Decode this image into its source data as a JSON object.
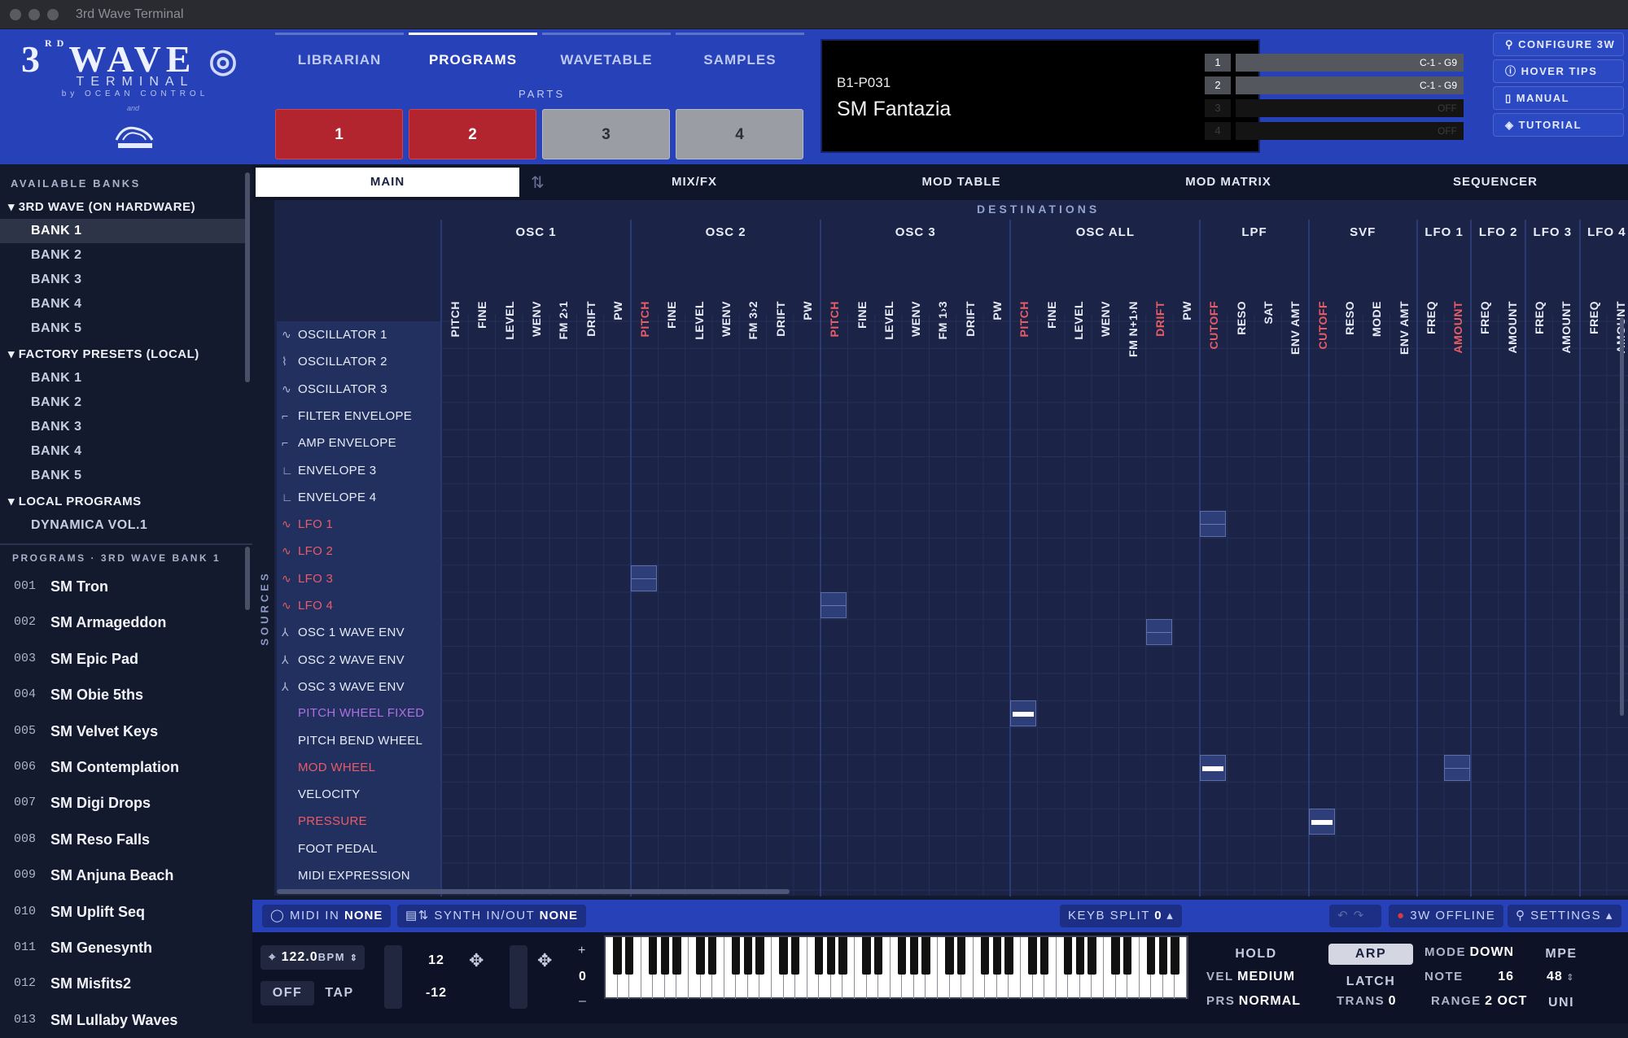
{
  "app": {
    "window_title": "3rd Wave Terminal"
  },
  "logo": {
    "wave": "3RDWAVE",
    "terminal": "TERMINAL",
    "by": "by OCEAN CONTROL",
    "and": "and"
  },
  "nav": {
    "tabs": [
      "LIBRARIAN",
      "PROGRAMS",
      "WAVETABLE",
      "SAMPLES"
    ],
    "active": "PROGRAMS"
  },
  "parts": {
    "label": "PARTS",
    "buttons": [
      "1",
      "2",
      "3",
      "4"
    ]
  },
  "display": {
    "program_id": "B1-P031",
    "program_name": "SM Fantazia",
    "parts": [
      {
        "n": "1",
        "range": "C-1 - G9"
      },
      {
        "n": "2",
        "range": "C-1 - G9"
      },
      {
        "n": "3",
        "range": "OFF"
      },
      {
        "n": "4",
        "range": "OFF"
      }
    ]
  },
  "right_buttons": [
    "CONFIGURE 3W",
    "HOVER TIPS",
    "MANUAL",
    "TUTORIAL"
  ],
  "sidebar": {
    "banks_header": "AVAILABLE BANKS",
    "groups": [
      {
        "title": "3RD WAVE (ON HARDWARE)",
        "items": [
          "BANK 1",
          "BANK 2",
          "BANK 3",
          "BANK 4",
          "BANK 5"
        ]
      },
      {
        "title": "FACTORY PRESETS (LOCAL)",
        "items": [
          "BANK 1",
          "BANK 2",
          "BANK 3",
          "BANK 4",
          "BANK 5"
        ]
      },
      {
        "title": "LOCAL PROGRAMS",
        "items": [
          "DYNAMICA VOL.1"
        ]
      }
    ],
    "programs_header": "PROGRAMS · 3RD WAVE BANK 1",
    "programs": [
      {
        "n": "001",
        "name": "SM Tron"
      },
      {
        "n": "002",
        "name": "SM Armageddon"
      },
      {
        "n": "003",
        "name": "SM Epic Pad"
      },
      {
        "n": "004",
        "name": "SM Obie 5ths"
      },
      {
        "n": "005",
        "name": "SM Velvet Keys"
      },
      {
        "n": "006",
        "name": "SM Contemplation"
      },
      {
        "n": "007",
        "name": "SM Digi Drops"
      },
      {
        "n": "008",
        "name": "SM Reso Falls"
      },
      {
        "n": "009",
        "name": "SM Anjuna Beach"
      },
      {
        "n": "010",
        "name": "SM Uplift Seq"
      },
      {
        "n": "011",
        "name": "SM Genesynth"
      },
      {
        "n": "012",
        "name": "SM Misfits2"
      },
      {
        "n": "013",
        "name": "SM Lullaby Waves"
      }
    ]
  },
  "subtabs": [
    "MAIN",
    "MIX/FX",
    "MOD TABLE",
    "MOD MATRIX",
    "SEQUENCER"
  ],
  "matrix": {
    "destinations_label": "DESTINATIONS",
    "sources_label": "SOURCES",
    "groups": [
      {
        "name": "OSC 1",
        "cols": [
          {
            "l": "PITCH",
            "red": false
          },
          {
            "l": "FINE"
          },
          {
            "l": "LEVEL"
          },
          {
            "l": "WENV"
          },
          {
            "l": "FM 2›1"
          },
          {
            "l": "DRIFT"
          },
          {
            "l": "PW"
          }
        ]
      },
      {
        "name": "OSC 2",
        "cols": [
          {
            "l": "PITCH",
            "red": true
          },
          {
            "l": "FINE"
          },
          {
            "l": "LEVEL"
          },
          {
            "l": "WENV"
          },
          {
            "l": "FM 3›2"
          },
          {
            "l": "DRIFT"
          },
          {
            "l": "PW"
          }
        ]
      },
      {
        "name": "OSC 3",
        "cols": [
          {
            "l": "PITCH",
            "red": true
          },
          {
            "l": "FINE"
          },
          {
            "l": "LEVEL"
          },
          {
            "l": "WENV"
          },
          {
            "l": "FM 1›3"
          },
          {
            "l": "DRIFT"
          },
          {
            "l": "PW"
          }
        ]
      },
      {
        "name": "OSC ALL",
        "cols": [
          {
            "l": "PITCH",
            "red": true
          },
          {
            "l": "FINE"
          },
          {
            "l": "LEVEL"
          },
          {
            "l": "WENV"
          },
          {
            "l": "FM N+1›N"
          },
          {
            "l": "DRIFT",
            "red": true
          },
          {
            "l": "PW"
          }
        ]
      },
      {
        "name": "LPF",
        "cols": [
          {
            "l": "CUTOFF",
            "red": true
          },
          {
            "l": "RESO"
          },
          {
            "l": "SAT"
          },
          {
            "l": "ENV AMT"
          }
        ]
      },
      {
        "name": "SVF",
        "cols": [
          {
            "l": "CUTOFF",
            "red": true
          },
          {
            "l": "RESO"
          },
          {
            "l": "MODE"
          },
          {
            "l": "ENV AMT"
          }
        ]
      },
      {
        "name": "LFO 1",
        "cols": [
          {
            "l": "FREQ"
          },
          {
            "l": "AMOUNT",
            "red": true
          }
        ]
      },
      {
        "name": "LFO 2",
        "cols": [
          {
            "l": "FREQ"
          },
          {
            "l": "AMOUNT"
          }
        ]
      },
      {
        "name": "LFO 3",
        "cols": [
          {
            "l": "FREQ"
          },
          {
            "l": "AMOUNT"
          }
        ]
      },
      {
        "name": "LFO 4",
        "cols": [
          {
            "l": "FREQ"
          },
          {
            "l": "AMOUNT"
          }
        ]
      }
    ],
    "sources": [
      {
        "l": "OSCILLATOR 1",
        "ic": "∿"
      },
      {
        "l": "OSCILLATOR 2",
        "ic": "⌇"
      },
      {
        "l": "OSCILLATOR 3",
        "ic": "∿"
      },
      {
        "l": "FILTER ENVELOPE",
        "ic": "⌐"
      },
      {
        "l": "AMP ENVELOPE",
        "ic": "⌐"
      },
      {
        "l": "ENVELOPE 3",
        "ic": "∟"
      },
      {
        "l": "ENVELOPE 4",
        "ic": "∟"
      },
      {
        "l": "LFO 1",
        "ic": "∿",
        "c": "red"
      },
      {
        "l": "LFO 2",
        "ic": "∿",
        "c": "red"
      },
      {
        "l": "LFO 3",
        "ic": "∿",
        "c": "red"
      },
      {
        "l": "LFO 4",
        "ic": "∿",
        "c": "red"
      },
      {
        "l": "OSC 1 WAVE ENV",
        "ic": "⅄"
      },
      {
        "l": "OSC 2 WAVE ENV",
        "ic": "⅄"
      },
      {
        "l": "OSC 3 WAVE ENV",
        "ic": "⅄"
      },
      {
        "l": "PITCH WHEEL FIXED",
        "ic": "",
        "c": "purple"
      },
      {
        "l": "PITCH BEND WHEEL",
        "ic": ""
      },
      {
        "l": "MOD WHEEL",
        "ic": "",
        "c": "red"
      },
      {
        "l": "VELOCITY",
        "ic": ""
      },
      {
        "l": "PRESSURE",
        "ic": "",
        "c": "red"
      },
      {
        "l": "FOOT PEDAL",
        "ic": ""
      },
      {
        "l": "MIDI EXPRESSION",
        "ic": ""
      }
    ],
    "marks": [
      {
        "row": 9,
        "col": 7,
        "bar": false
      },
      {
        "row": 7,
        "col": 28,
        "bar": false
      },
      {
        "row": 10,
        "col": 14,
        "bar": false
      },
      {
        "row": 11,
        "col": 26,
        "bar": false
      },
      {
        "row": 14,
        "col": 21,
        "bar": true
      },
      {
        "row": 16,
        "col": 28,
        "bar": true
      },
      {
        "row": 16,
        "col": 37,
        "bar": false
      },
      {
        "row": 18,
        "col": 32,
        "bar": true
      }
    ]
  },
  "bottombar": {
    "midi_in_label": "MIDI IN",
    "midi_in_value": "NONE",
    "synth_io_label": "SYNTH IN/OUT",
    "synth_io_value": "NONE",
    "keyb_split_label": "KEYB SPLIT",
    "keyb_split_value": "0",
    "status": "3W OFFLINE",
    "settings": "SETTINGS"
  },
  "controls": {
    "bpm": "122.0",
    "bpm_unit": "BPM",
    "off": "OFF",
    "tap": "TAP",
    "range_hi": "12",
    "range_lo": "-12",
    "zero": "0",
    "hold": "HOLD",
    "vel_label": "VEL",
    "vel_value": "MEDIUM",
    "prs_label": "PRS",
    "prs_value": "NORMAL",
    "arp": "ARP",
    "latch": "LATCH",
    "trans_label": "TRANS",
    "trans_value": "0",
    "mode_label": "MODE",
    "mode_value": "DOWN",
    "note_label": "NOTE",
    "note_value": "16",
    "range_label": "RANGE",
    "range_value": "2 OCT",
    "mpe": "MPE",
    "mpe_value": "48",
    "uni": "UNI"
  }
}
